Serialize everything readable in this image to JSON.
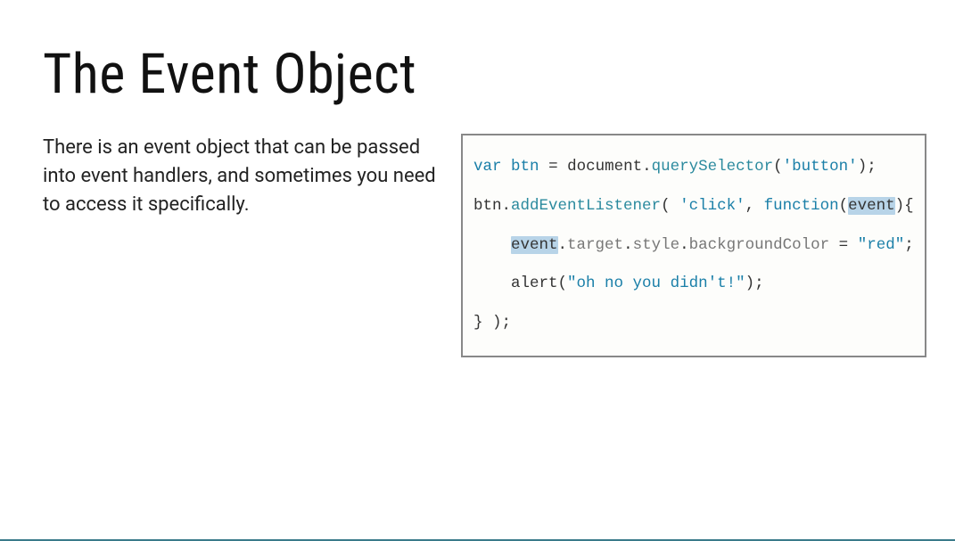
{
  "slide": {
    "title": "The Event Object",
    "description": "There is an event object that can be passed into event handlers, and sometimes you need to access it specifically.",
    "code": {
      "line1": {
        "kw_var": "var",
        "sp1": " ",
        "varname": "btn",
        "sp2": " ",
        "eq": "=",
        "sp3": " ",
        "doc": "document",
        "dot1": ".",
        "qs": "querySelector",
        "paren1": "(",
        "str1": "'button'",
        "paren2": ")",
        "semi1": ";"
      },
      "line2": {
        "btn": "btn",
        "dot": ".",
        "ael": "addEventListener",
        "paren1": "( ",
        "str_click": "'click'",
        "comma": ", ",
        "func": "function",
        "paren2": "(",
        "evt": "event",
        "paren3": "){"
      },
      "line3": {
        "indent": "    ",
        "evt": "event",
        "dot1": ".",
        "target": "target",
        "dot2": ".",
        "style": "style",
        "dot3": ".",
        "bgc": "backgroundColor",
        "sp1": " ",
        "eq": "=",
        "sp2": " ",
        "str_red": "\"red\"",
        "semi": ";"
      },
      "line4": {
        "indent": "    ",
        "alert": "alert",
        "paren1": "(",
        "str": "\"oh no you didn't!\"",
        "paren2": ")",
        "semi": ";"
      },
      "line5": {
        "close": "} );"
      }
    }
  }
}
